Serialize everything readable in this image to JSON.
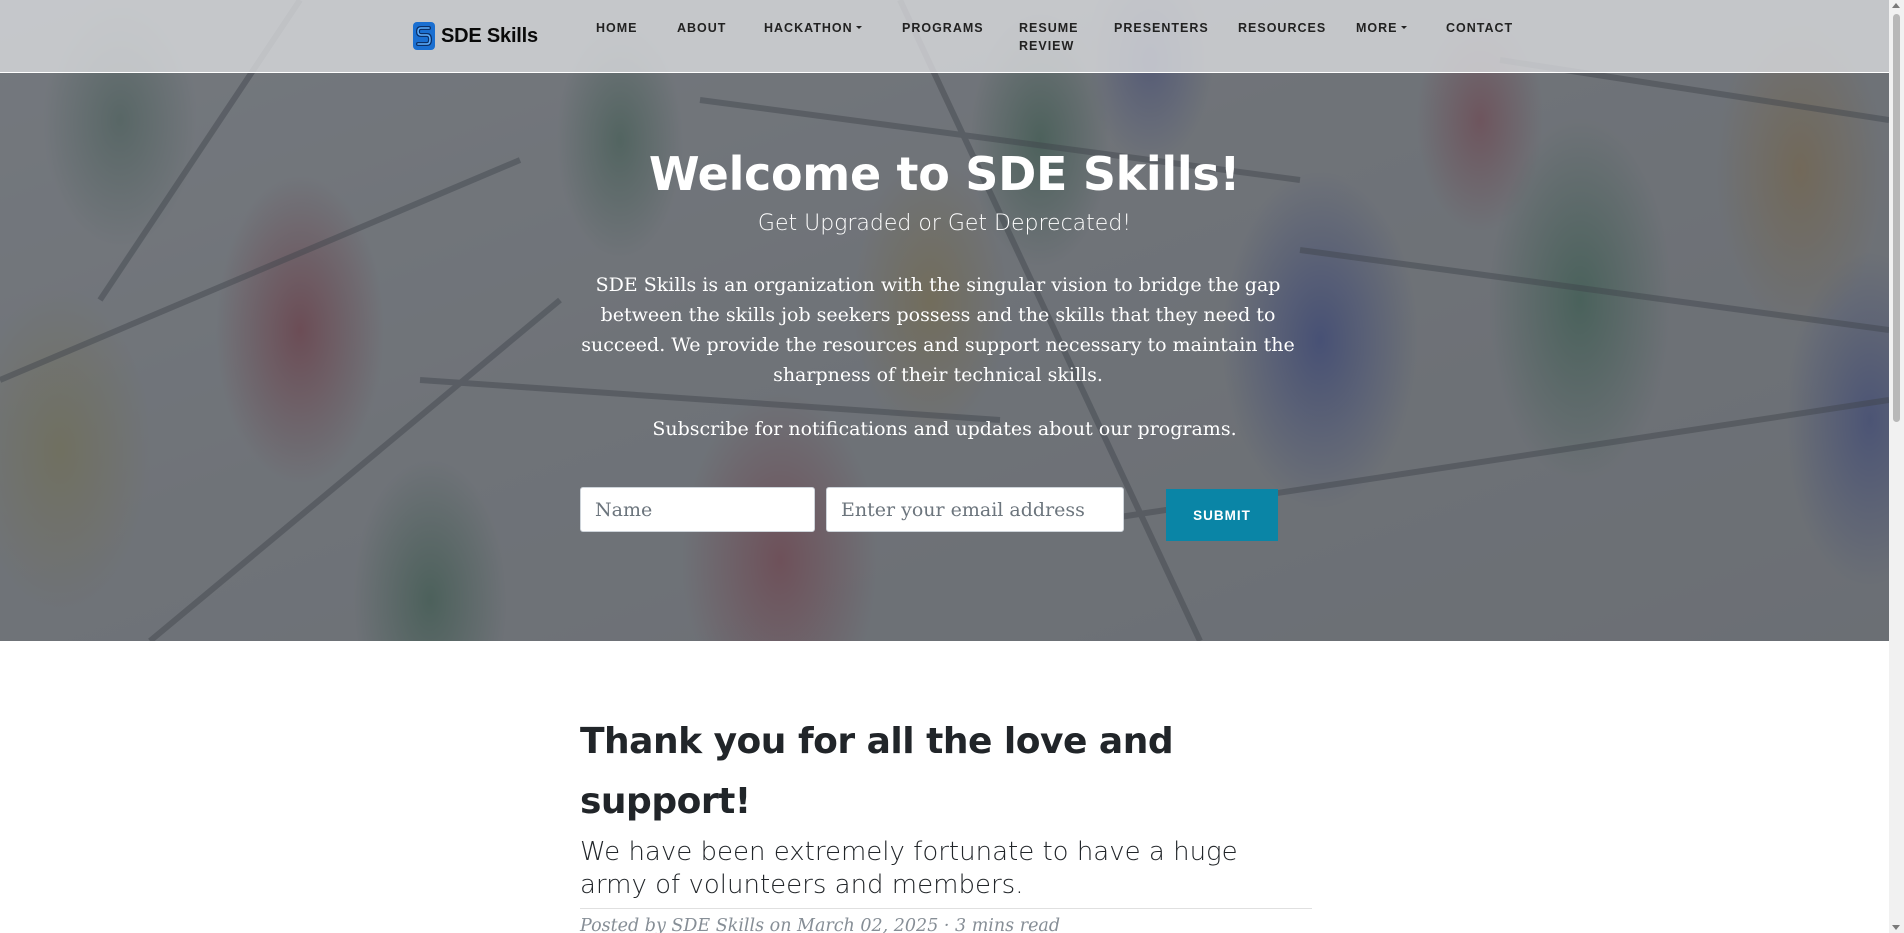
{
  "brand": {
    "name": "SDE Skills",
    "logo_letter": "S",
    "logo_color": "#1a6fd1"
  },
  "nav": {
    "items": [
      {
        "label": "HOME",
        "dropdown": false
      },
      {
        "label": "ABOUT",
        "dropdown": false
      },
      {
        "label": "HACKATHON",
        "dropdown": true
      },
      {
        "label": "PROGRAMS",
        "dropdown": false
      },
      {
        "label_line1": "RESUME",
        "label_line2": "REVIEW",
        "dropdown": false
      },
      {
        "label": "PRESENTERS",
        "dropdown": false
      },
      {
        "label": "RESOURCES",
        "dropdown": false
      },
      {
        "label": "MORE",
        "dropdown": true
      },
      {
        "label": "CONTACT",
        "dropdown": false
      }
    ]
  },
  "hero": {
    "title": "Welcome to SDE Skills!",
    "subtitle": "Get Upgraded or Get Deprecated!",
    "description": "SDE Skills is an organization with the singular vision to bridge the gap between the skills job seekers possess and the skills that they need to succeed. We provide the resources and support necessary to maintain the sharpness of their technical skills.",
    "subscribe_text": "Subscribe for notifications and updates about our programs.",
    "name_placeholder": "Name",
    "email_placeholder": "Enter your email address",
    "submit_label": "SUBMIT"
  },
  "post": {
    "title": "Thank you for all the love and support!",
    "subtitle": "We have been extremely fortunate to have a huge army of volunteers and members.",
    "meta": "Posted by SDE Skills on March 02, 2025 · 3 mins read"
  },
  "colors": {
    "accent": "#0a85a6",
    "text_dark": "#212529",
    "meta_gray": "#868e96"
  }
}
